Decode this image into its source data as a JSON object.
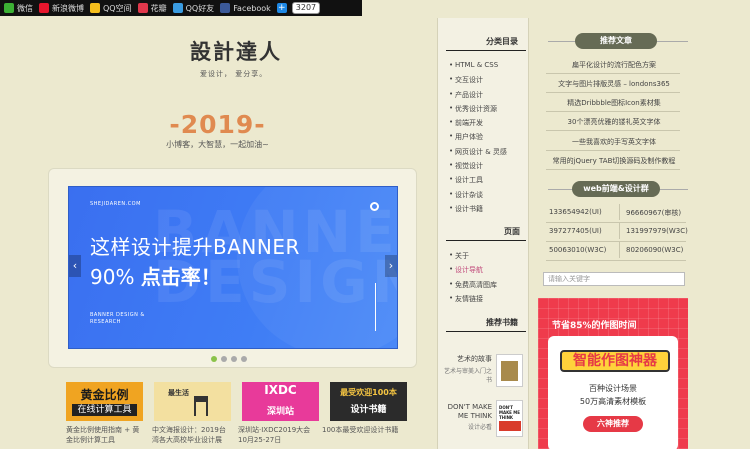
{
  "share_bar": {
    "items": [
      {
        "label": "微信",
        "icon": "wechat-icon",
        "color": "#3cb034"
      },
      {
        "label": "新浪微博",
        "icon": "weibo-icon",
        "color": "#e6162d"
      },
      {
        "label": "QQ空间",
        "icon": "qzone-icon",
        "color": "#f5be1c"
      },
      {
        "label": "花瓣",
        "icon": "huaban-icon",
        "color": "#e0374b"
      },
      {
        "label": "QQ好友",
        "icon": "qq-icon",
        "color": "#3a9be0"
      },
      {
        "label": "Facebook",
        "icon": "facebook-icon",
        "color": "#3b5998"
      }
    ],
    "count": "3207"
  },
  "site": {
    "title": "設計達人",
    "subtitle": "爱设计， 爱分享。",
    "year": "-2019-",
    "tagline": "小博客，大智慧，一起加油~"
  },
  "banner": {
    "site": "SHEJIDAREN.COM",
    "headline1": "这样设计提升BANNER",
    "headline2_pre": "90% ",
    "headline2_bold": "点击率！",
    "ghost": "BANNER DESIGN",
    "small": "BANNER DESIGN & RESEARCH",
    "prev": "‹",
    "next": "›"
  },
  "thumbs": [
    {
      "title1": "黄金比例",
      "title2": "在线计算工具",
      "caption": "黄金比例使用指南 + 黄金比例计算工具",
      "bg": "#f0a421"
    },
    {
      "title1": "最生活",
      "title2": "",
      "caption": "中文海报设计：2019台湾各大高校毕业设计展",
      "bg": "#f3e0a0"
    },
    {
      "title1": "IXDC",
      "title2": "深圳站",
      "caption": "深圳站·IXDC2019大会10月25-27日",
      "bg": "#e83a9a"
    },
    {
      "title1": "最受欢迎100本",
      "title2": "设计书籍",
      "caption": "100本最受欢迎设计书籍",
      "bg": "#2b2b2b"
    }
  ],
  "middle": {
    "categories_title": "分类目录",
    "categories": [
      "HTML & CSS",
      "交互设计",
      "产品设计",
      "优秀设计资源",
      "前端开发",
      "用户体验",
      "网页设计 & 灵感",
      "视觉设计",
      "设计工具",
      "设计杂谈",
      "设计书籍"
    ],
    "pages_title": "页面",
    "pages": [
      "关于",
      "设计导航",
      "免费高清图库",
      "友情链接"
    ],
    "books_title": "推荐书籍",
    "books": [
      {
        "title": "艺术的故事",
        "sub": "艺术与审美入门之书"
      },
      {
        "title": "DON'T MAKE ME THINK",
        "sub": "设计必看"
      }
    ]
  },
  "right": {
    "articles_title": "推荐文章",
    "articles": [
      "扁平化设计的流行配色方案",
      "文字与图片排版灵感 – londons365",
      "精选Dribbble图标Icon素材集",
      "30个漂亮优雅的镂礼英文字体",
      "一些我喜欢的手写英文字体",
      "常用的jQuery TAB切换源码及制作教程"
    ],
    "groups_title": "web前端&设计群",
    "groups": [
      [
        "133654942(UI)",
        "96660967(审核)"
      ],
      [
        "397277405(UI)",
        "131997979(W3C)"
      ],
      [
        "50063010(W3C)",
        "80206090(W3C)"
      ]
    ],
    "search_placeholder": "请输入关键字",
    "ad": {
      "top": "节省85%的作图时间",
      "title": "智能作图神器",
      "line1": "百种设计场景",
      "line2": "50万高清素材模板",
      "button": "六神推荐"
    }
  }
}
